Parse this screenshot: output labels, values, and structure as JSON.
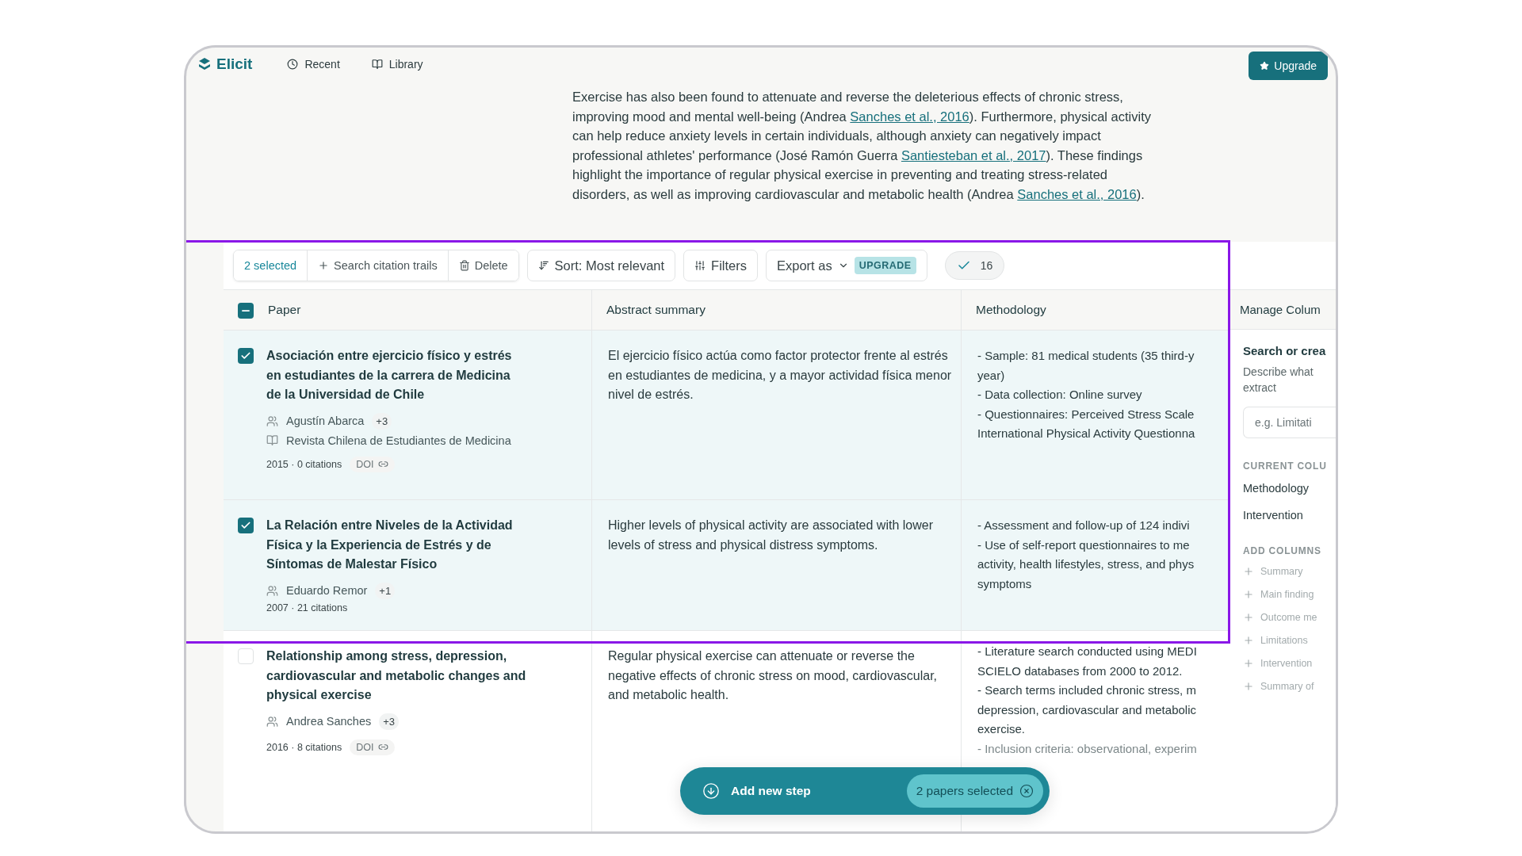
{
  "nav": {
    "brand": "Elicit",
    "links": [
      {
        "label": "Recent"
      },
      {
        "label": "Library"
      }
    ],
    "upgrade": "Upgrade"
  },
  "summary": [
    {
      "kind": "text",
      "text": "Exercise has also been found to attenuate and reverse the deleterious effects of chronic stress, improving mood and mental well-being (Andrea "
    },
    {
      "kind": "link",
      "text": "Sanches et al., 2016"
    },
    {
      "kind": "text",
      "text": "). Furthermore, physical activity can help reduce anxiety levels in certain individuals, although anxiety can negatively impact professional athletes' performance (José Ramón Guerra "
    },
    {
      "kind": "link",
      "text": "Santiesteban et al., 2017"
    },
    {
      "kind": "text",
      "text": "). These findings highlight the importance of regular physical exercise in preventing and treating stress-related disorders, as well as improving cardiovascular and metabolic health (Andrea "
    },
    {
      "kind": "link",
      "text": "Sanches et al., 2016"
    },
    {
      "kind": "text",
      "text": ")."
    }
  ],
  "toolbar": {
    "selection": "2 selected",
    "actions": [
      {
        "label": "Search citation trails",
        "kind": "add"
      },
      {
        "label": "Delete",
        "kind": "delete"
      }
    ],
    "sort": "Sort: Most relevant",
    "filters": "Filters",
    "export": "Export as",
    "export_badge": "UPGRADE",
    "count": "16"
  },
  "table": {
    "select_all": {
      "mixed": true
    },
    "columns": [
      {
        "label": "Paper"
      },
      {
        "label": "Abstract summary"
      },
      {
        "label": "Methodology"
      }
    ],
    "rows": [
      {
        "selected": true,
        "title": "Asociación entre ejercicio físico y estrés en estudiantes de la carrera de Medicina de la Universidad de Chile",
        "author": "Agustín Abarca",
        "more_authors": "+3",
        "journal": "Revista Chilena de Estudiantes de Medicina",
        "meta": "2015 · 0 citations",
        "doi": "DOI",
        "abstract": "El ejercicio físico actúa como factor protector frente al estrés en estudiantes de medicina, y a mayor actividad física menor nivel de estrés.",
        "methodology": [
          {
            "text": "- Sample: 81 medical students (35 third-y",
            "faded": false
          },
          {
            "text": "year)",
            "faded": false
          },
          {
            "text": "- Data collection: Online survey",
            "faded": false
          },
          {
            "text": "- Questionnaires: Perceived Stress Scale",
            "faded": false
          },
          {
            "text": "International Physical Activity Questionna",
            "faded": false
          }
        ]
      },
      {
        "selected": true,
        "title": "La Relación entre Niveles de la Actividad Física y la Experiencia de Estrés y de Síntomas de Malestar Físico",
        "author": "Eduardo Remor",
        "more_authors": "+1",
        "meta": "2007 · 21 citations",
        "abstract": "Higher levels of physical activity are associated with lower levels of stress and physical distress symptoms.",
        "methodology": [
          {
            "text": "- Assessment and follow-up of 124 indivi",
            "faded": false
          },
          {
            "text": "- Use of self-report questionnaires to me",
            "faded": false
          },
          {
            "text": "activity, health lifestyles, stress, and phys",
            "faded": false
          },
          {
            "text": "symptoms",
            "faded": false
          }
        ]
      },
      {
        "selected": false,
        "title": "Relationship among stress, depression, cardiovascular and metabolic changes and physical exercise",
        "author": "Andrea Sanches",
        "more_authors": "+3",
        "meta": "2016 · 8 citations",
        "doi": "DOI",
        "abstract": "Regular physical exercise can attenuate or reverse the negative effects of chronic stress on mood, cardiovascular, and metabolic health.",
        "methodology": [
          {
            "text": "- Literature search conducted using MEDI",
            "faded": false
          },
          {
            "text": "SCIELO databases from 2000 to 2012.",
            "faded": false
          },
          {
            "text": "- Search terms included chronic stress, m",
            "faded": false
          },
          {
            "text": "depression, cardiovascular and metabolic",
            "faded": false
          },
          {
            "text": "exercise.",
            "faded": false
          },
          {
            "text": "- Inclusion criteria: observational, experim",
            "faded": true
          }
        ]
      }
    ]
  },
  "manage_panel": {
    "title": "Manage Colum",
    "search_title": "Search or crea",
    "description": [
      "Describe what",
      "extract"
    ],
    "placeholder": "e.g. Limitati",
    "current_heading": "CURRENT COLU",
    "current": [
      "Methodology",
      "Intervention"
    ],
    "add_heading": "ADD COLUMNS",
    "add": [
      "Summary",
      "Main finding",
      "Outcome me",
      "Limitations",
      "Intervention",
      "Summary of"
    ]
  },
  "floating_bar": {
    "action": "Add new step",
    "selection": "2 papers selected"
  }
}
